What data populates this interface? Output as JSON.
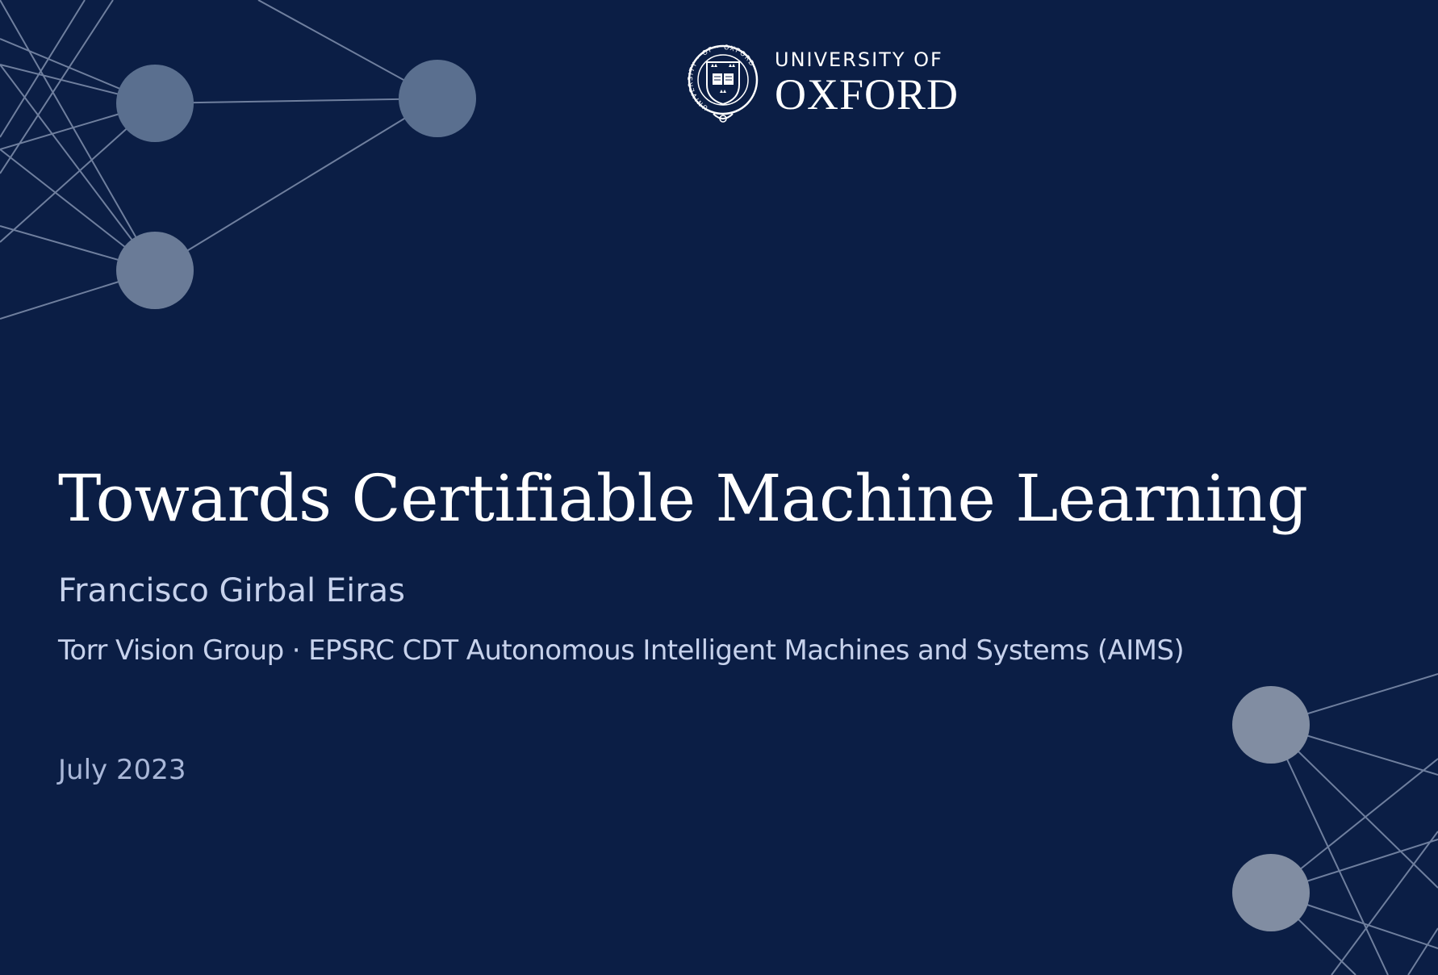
{
  "logo": {
    "line1": "UNIVERSITY OF",
    "line2": "OXFORD",
    "crest_ring_text": "UNIVERSITY · OF · OXFORD"
  },
  "title": "Towards Certifiable Machine Learning",
  "author": "Francisco Girbal Eiras",
  "affiliation": "Torr Vision Group · EPSRC CDT Autonomous Intelligent Machines and Systems (AIMS)",
  "date": "July 2023",
  "colors": {
    "background": "#0b1e45",
    "title": "#ffffff",
    "subtitle": "#c7d2ec",
    "node_top": "#5a6f8f",
    "node_bottom": "#818da2",
    "edge": "#6f7f9e"
  }
}
